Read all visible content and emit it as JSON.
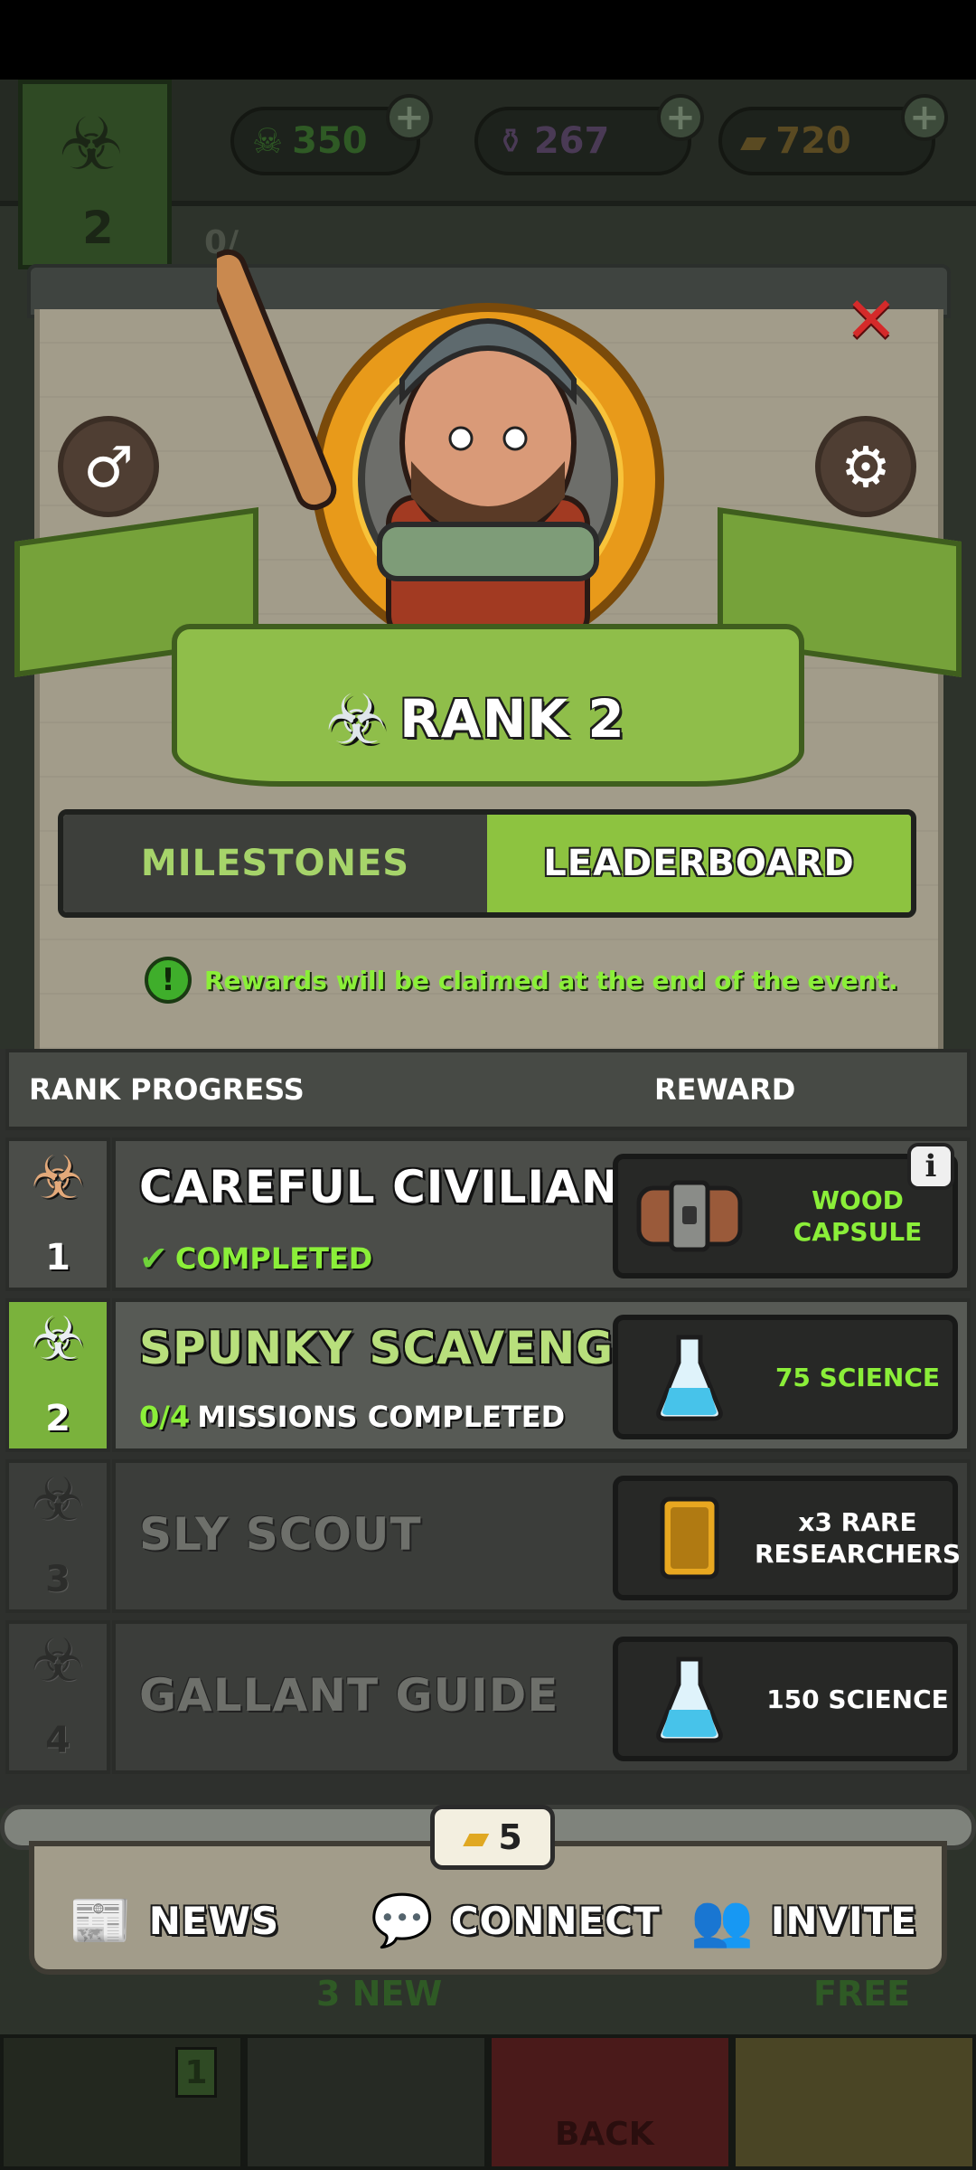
{
  "resources": [
    {
      "name": "skulls",
      "value": "350"
    },
    {
      "name": "potions",
      "value": "267"
    },
    {
      "name": "gold",
      "value": "720"
    }
  ],
  "background": {
    "rank_number": "2",
    "progress_partial": "0/",
    "news_count_label": "3 NEW",
    "free_label": "FREE",
    "back_label": "BACK",
    "flag_badge": "1"
  },
  "modal": {
    "rank_title": "RANK 2",
    "tabs": {
      "milestones": "MILESTONES",
      "leaderboard": "LEADERBOARD",
      "selected": "leaderboard"
    },
    "notice": "Rewards will be claimed at the end of the event."
  },
  "table": {
    "header_rank_progress": "RANK PROGRESS",
    "header_reward": "REWARD",
    "rows": [
      {
        "rank": "1",
        "name": "CAREFUL CIVILIAN",
        "status": "COMPLETED",
        "reward": "WOOD CAPSULE",
        "reward_line1": "WOOD",
        "reward_line2": "CAPSULE",
        "state": "completed"
      },
      {
        "rank": "2",
        "name": "SPUNKY SCAVENGER",
        "progress_count": "0/4",
        "progress_text": "MISSIONS COMPLETED",
        "reward": "75 SCIENCE",
        "state": "current"
      },
      {
        "rank": "3",
        "name": "SLY SCOUT",
        "reward_line1": "x3 RARE",
        "reward_line2": "RESEARCHERS",
        "state": "locked"
      },
      {
        "rank": "4",
        "name": "GALLANT GUIDE",
        "reward": "150 SCIENCE",
        "state": "locked"
      }
    ]
  },
  "bottom_bar": {
    "ticket_count": "5",
    "news": "NEWS",
    "connect": "CONNECT",
    "invite": "INVITE"
  },
  "colors": {
    "accent_green": "#8dc340",
    "notice_green": "#8bef39",
    "close_red": "#d52a2a",
    "wood": "#a29c8a"
  }
}
